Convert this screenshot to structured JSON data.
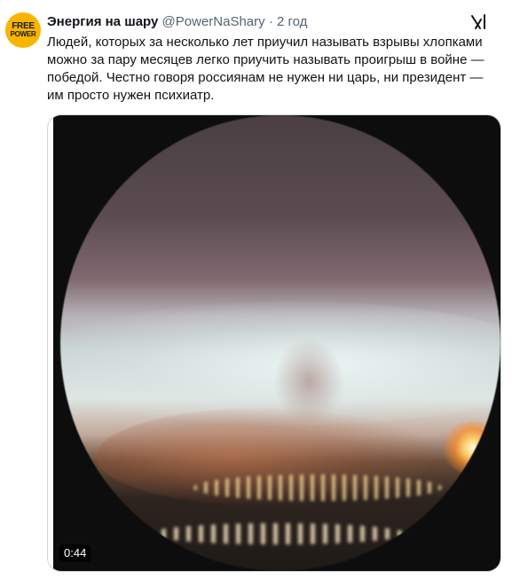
{
  "tweet": {
    "avatar": {
      "line1": "FREE",
      "line2": "POWER",
      "color": "#f7b500"
    },
    "author_name": "Энергия на шару",
    "author_handle": "@PowerNaShary",
    "separator": "·",
    "timestamp": "2 год",
    "header_icon": "grok-icon",
    "text": "Людей, которых за несколько лет приучил называть взрывы хлопками можно за пару месяцев легко приучить называть проигрыш в войне — победой. Честно говоря россиянам не нужен ни царь, ни президент — им просто нужен психиатр.",
    "media": {
      "type": "video",
      "duration": "0:44"
    }
  }
}
